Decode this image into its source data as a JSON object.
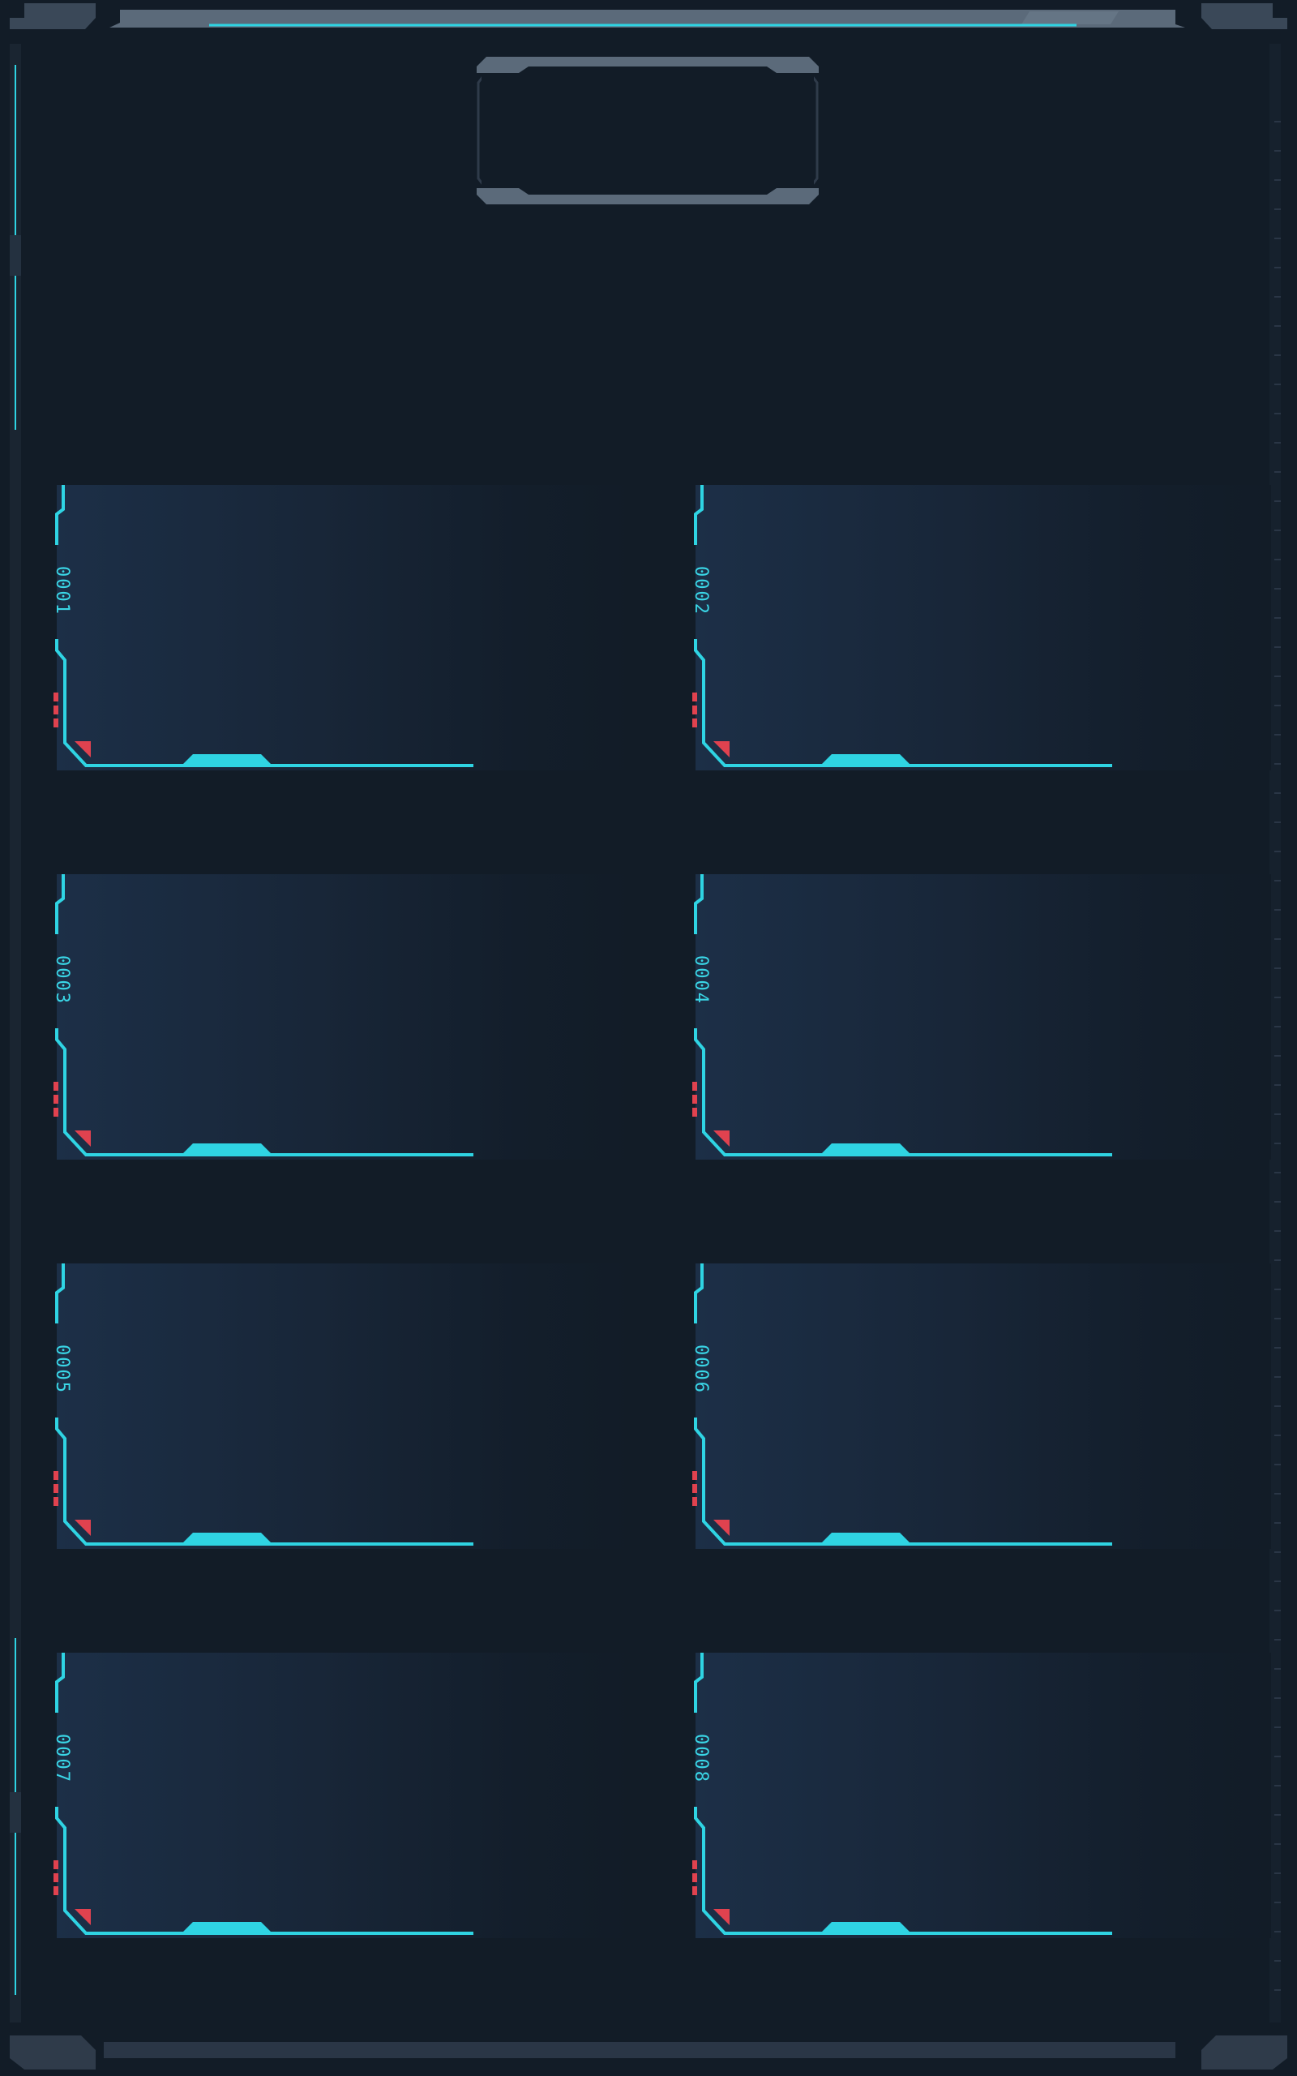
{
  "screen": {
    "title": "",
    "theme": {
      "accent": "#2fd4e3",
      "alert": "#e0424f",
      "frame": "#5e6e80",
      "frame_dark": "#2a3646",
      "background": "#121c27"
    }
  },
  "slots": [
    {
      "id": "0001"
    },
    {
      "id": "0002"
    },
    {
      "id": "0003"
    },
    {
      "id": "0004"
    },
    {
      "id": "0005"
    },
    {
      "id": "0006"
    },
    {
      "id": "0007"
    },
    {
      "id": "0008"
    }
  ]
}
